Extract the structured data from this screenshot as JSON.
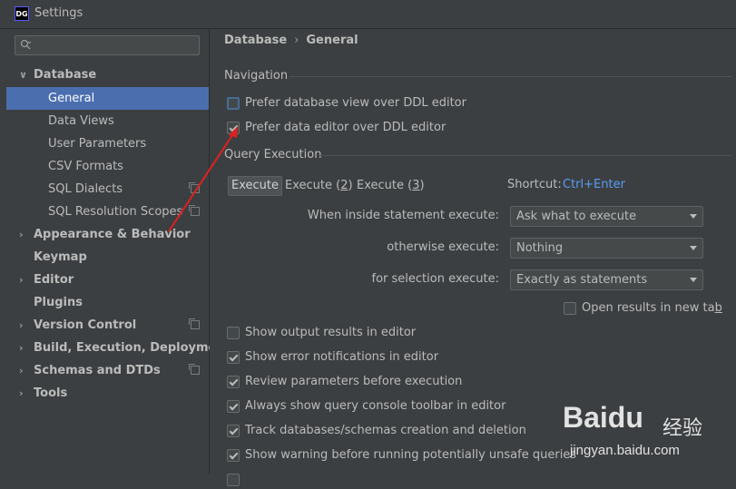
{
  "window": {
    "title": "Settings",
    "logo_text": "DG"
  },
  "sidebar": {
    "search": {
      "value": "",
      "placeholder": ""
    },
    "items": [
      {
        "label": "Database",
        "expanded": true
      },
      {
        "label": "General",
        "selected": true
      },
      {
        "label": "Data Views"
      },
      {
        "label": "User Parameters"
      },
      {
        "label": "CSV Formats"
      },
      {
        "label": "SQL Dialects"
      },
      {
        "label": "SQL Resolution Scopes"
      },
      {
        "label": "Appearance & Behavior"
      },
      {
        "label": "Keymap"
      },
      {
        "label": "Editor"
      },
      {
        "label": "Plugins"
      },
      {
        "label": "Version Control"
      },
      {
        "label": "Build, Execution, Deployment"
      },
      {
        "label": "Schemas and DTDs"
      },
      {
        "label": "Tools"
      }
    ]
  },
  "breadcrumb": {
    "parent": "Database",
    "separator": "›",
    "current": "General"
  },
  "navigation": {
    "title": "Navigation",
    "options": [
      {
        "label": "Prefer database view over DDL editor",
        "checked": false
      },
      {
        "label": "Prefer data editor over DDL editor",
        "checked": true
      }
    ]
  },
  "query_execution": {
    "title": "Query Execution",
    "tabs": [
      {
        "label": "Execute",
        "active": true
      },
      {
        "label_prefix": "Execute (",
        "mnemonic": "2",
        "label_suffix": ")"
      },
      {
        "label_prefix": "Execute (",
        "mnemonic": "3",
        "label_suffix": ")"
      }
    ],
    "shortcut_label": "Shortcut:",
    "shortcut_value": "Ctrl+Enter",
    "fields": [
      {
        "label": "When inside statement execute:",
        "value": "Ask what to execute"
      },
      {
        "label": "otherwise execute:",
        "value": "Nothing"
      },
      {
        "label": "for selection execute:",
        "value": "Exactly as statements"
      }
    ],
    "open_in_new_tab": {
      "label_prefix": "Open results in new ta",
      "mnemonic": "b",
      "checked": false
    }
  },
  "options": [
    {
      "label": "Show output results in editor",
      "checked": false
    },
    {
      "label": "Show error notifications in editor",
      "checked": true
    },
    {
      "label": "Review parameters before execution",
      "checked": true
    },
    {
      "label": "Always show query console toolbar in editor",
      "checked": true
    },
    {
      "label": "Track databases/schemas creation and deletion",
      "checked": true
    },
    {
      "label": "Show warning before running potentially unsafe queries",
      "checked": true
    }
  ],
  "watermark": {
    "logo": "Bai",
    "paw": "du",
    "cn": "经验",
    "url": "jingyan.baidu.com"
  },
  "colors": {
    "background": "#3c3f41",
    "selection": "#4b6eaf",
    "link": "#589df6",
    "annotation_arrow": "#e02020"
  }
}
